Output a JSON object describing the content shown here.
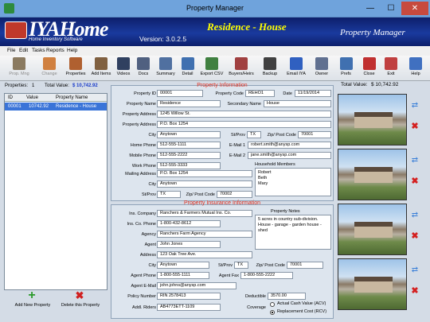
{
  "window": {
    "title": "Property Manager",
    "min": "—",
    "max": "☐",
    "close": "✕"
  },
  "banner": {
    "logo": "IYAHome",
    "logo_sub": "Home Inventory Software",
    "version": "Version: 3.0.2.5",
    "residence": "Residence - House",
    "app": "Property Manager"
  },
  "menu": [
    "File",
    "Edit",
    "Tasks",
    "Reports",
    "Help"
  ],
  "toolbar": [
    {
      "label": "Prop. Mng",
      "disabled": true,
      "color": "#8a7a60"
    },
    {
      "label": "Change",
      "disabled": true,
      "color": "#d08040"
    },
    {
      "label": "Properties",
      "disabled": false,
      "color": "#b06030"
    },
    {
      "label": "Add Items",
      "disabled": false,
      "color": "#806040"
    },
    {
      "label": "Videos",
      "disabled": false,
      "color": "#304060"
    },
    {
      "label": "Docs",
      "disabled": false,
      "color": "#506080"
    },
    {
      "label": "Summary",
      "disabled": false,
      "color": "#5070a0"
    },
    {
      "label": "Detail",
      "disabled": false,
      "color": "#4070b0"
    },
    {
      "label": "Export CSV",
      "disabled": false,
      "color": "#408040"
    },
    {
      "label": "Buyers/Heirs",
      "disabled": false,
      "color": "#a04040"
    },
    {
      "label": "Backup",
      "disabled": false,
      "color": "#404040"
    },
    {
      "label": "Email IYA",
      "disabled": false,
      "color": "#3060c0"
    },
    {
      "label": "Owner",
      "disabled": false,
      "color": "#607090"
    },
    {
      "label": "Prefs",
      "disabled": false,
      "color": "#4070b0"
    },
    {
      "label": "Close",
      "disabled": false,
      "color": "#c03030"
    },
    {
      "label": "Exit",
      "disabled": false,
      "color": "#c04040"
    },
    {
      "label": "Help",
      "disabled": false,
      "color": "#4070c0"
    }
  ],
  "status": {
    "properties_label": "Properties:",
    "properties_count": "1",
    "total_value_label": "Total Value:",
    "total_value": "$ 10,742.92",
    "right_total_label": "Total Value:",
    "right_total": "$ 10,742.92"
  },
  "grid": {
    "headers": [
      "ID",
      "Value",
      "Property Name"
    ],
    "rows": [
      [
        "00001",
        "10742.92",
        "Residence - House"
      ]
    ]
  },
  "left_buttons": {
    "add": "Add New Property",
    "delete": "Delete this Property"
  },
  "property_info": {
    "title": "Property Information",
    "property_id_label": "Property ID",
    "property_id": "00001",
    "property_code_label": "Property Code",
    "property_code": "REHO1",
    "date_label": "Date",
    "date": "11/19/2014",
    "property_name_label": "Property Name",
    "property_name": "Residence",
    "secondary_name_label": "Secondary Name",
    "secondary_name": "House",
    "address1_label": "Property Address",
    "address1": "1245 Willow St.",
    "address2_label": "Property Address",
    "address2": "P.O. Box 1254",
    "city_label": "City",
    "city": "Anytown",
    "stprov_label": "St/Prov",
    "stprov": "TX",
    "zip_label": "Zip/ Post Code",
    "zip": "70001",
    "home_phone_label": "Home Phone",
    "home_phone": "512-555-1111",
    "email1_label": "E-Mail 1",
    "email1": "robert.smith@anysp.com",
    "mobile_phone_label": "Mobile Phone",
    "mobile_phone": "512-555-2222",
    "email2_label": "E-Mail 2",
    "email2": "jane.smith@anysp.com",
    "work_phone_label": "Work Phone",
    "work_phone": "512-555-3333",
    "household_label": "Household Members",
    "household": [
      "Robert",
      "Beth",
      "Mary"
    ],
    "mail_address_label": "Mailing Address",
    "mail_address": "P.O. Box 1254",
    "mail_city_label": "City",
    "mail_city": "Anytown",
    "mail_stprov_label": "St/Prov",
    "mail_stprov": "TX",
    "mail_zip_label": "Zip/ Post Code",
    "mail_zip": "70002"
  },
  "insurance": {
    "title": "Property Insurance Information",
    "company_label": "Ins. Company",
    "company": "Ranchers & Farmers Mutual Ins. Co.",
    "phone_label": "Ins. Co. Phone",
    "phone": "1-800-432-8612",
    "notes_label": "Property Notes",
    "notes": "5 acres in country sub-division. House - garage - garden house - shed",
    "agency_label": "Agency",
    "agency": "Ranchers Farm Agency",
    "agent_label": "Agent",
    "agent": "John Jones",
    "address_label": "Address",
    "address": "123 Oak Tree Ave.",
    "city_label": "City",
    "city": "Anytown",
    "stprov_label": "St/Prov",
    "stprov": "TX",
    "zip_label": "Zip/ Post Code",
    "zip": "70001",
    "agent_phone_label": "Agent Phone",
    "agent_phone": "1-800-555-1111",
    "agent_fax_label": "Agent Fax",
    "agent_fax": "1-800-555-2222",
    "agent_email_label": "Agent E-Mail",
    "agent_email": "john.johns@anysp.com",
    "policy_label": "Policy Number",
    "policy": "RIN 2578413",
    "deductible_label": "Deductible",
    "deductible": "3570.00",
    "riders_label": "Addl. Riders",
    "riders": "AB4773ETT-1109",
    "coverage_label": "Coverage",
    "coverage_acv": "Actual Cash Value (ACV)",
    "coverage_rcv": "Replacement Cost (RCV)"
  },
  "photos": {
    "update_icon": "⇄",
    "delete_icon": "✖"
  }
}
